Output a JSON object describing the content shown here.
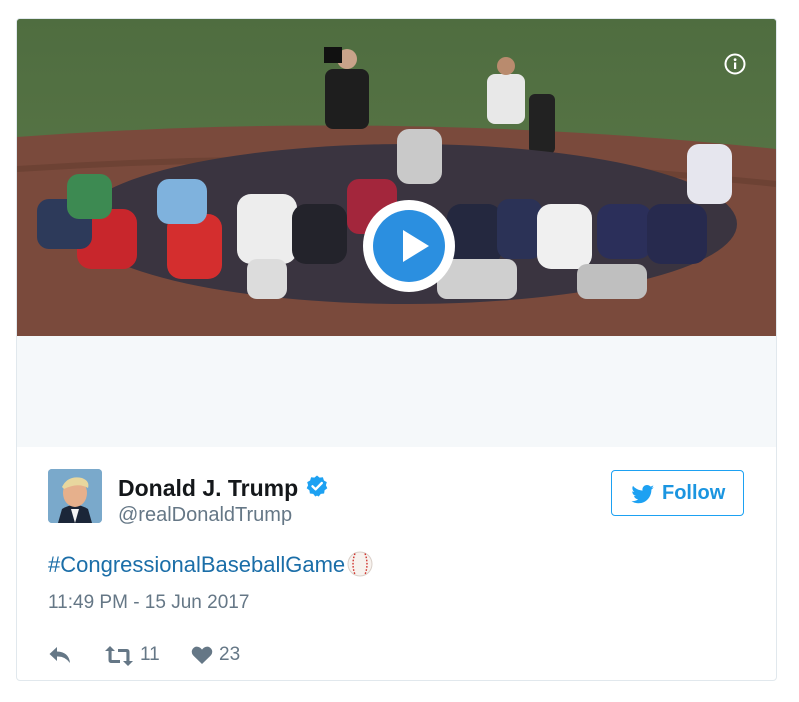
{
  "tweet": {
    "display_name": "Donald J. Trump",
    "handle": "@realDonaldTrump",
    "follow_label": "Follow",
    "hashtag": "#CongressionalBaseballGame",
    "timestamp": "11:49 PM - 15 Jun 2017",
    "retweet_count": "11",
    "like_count": "23"
  },
  "colors": {
    "accent": "#1da1f2",
    "link": "#1b6ea8",
    "muted": "#657786",
    "play": "#2b8fe0"
  },
  "icons": [
    "info-icon",
    "play-icon",
    "verified-icon",
    "twitter-bird-icon",
    "baseball-emoji-icon",
    "reply-icon",
    "retweet-icon",
    "heart-icon"
  ]
}
